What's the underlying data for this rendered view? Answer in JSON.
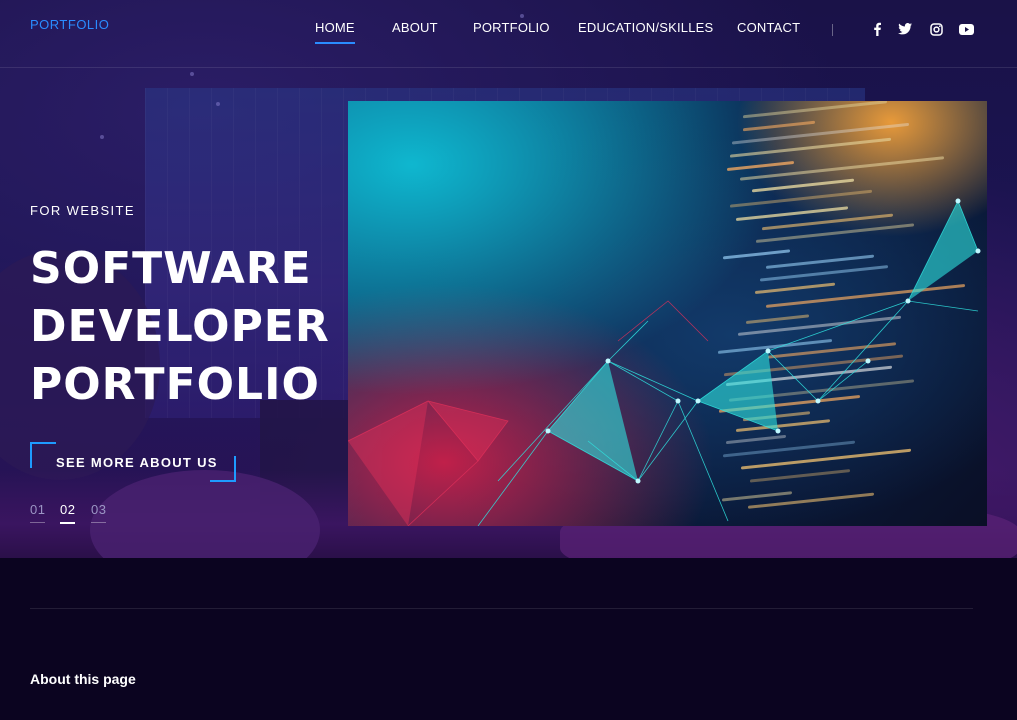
{
  "header": {
    "logo": "PORTFOLIO",
    "nav": [
      {
        "label": "HOME",
        "active": true
      },
      {
        "label": "ABOUT",
        "active": false
      },
      {
        "label": "PORTFOLIO",
        "active": false
      },
      {
        "label": "EDUCATION/SKILLES",
        "active": false
      },
      {
        "label": "CONTACT",
        "active": false
      }
    ],
    "social": [
      "facebook-icon",
      "twitter-icon",
      "instagram-icon",
      "youtube-icon"
    ]
  },
  "hero": {
    "eyebrow": "FOR WEBSITE",
    "headline": [
      "SOFTWARE",
      "DEVELOPER",
      "PORTFOLIO"
    ],
    "cta_label": "SEE MORE ABOUT US",
    "pager": [
      {
        "label": "01",
        "active": false
      },
      {
        "label": "02",
        "active": true
      },
      {
        "label": "03",
        "active": false
      }
    ]
  },
  "about": {
    "title": "About this page"
  },
  "colors": {
    "accent": "#2a8cff",
    "background": "#0b0420"
  }
}
